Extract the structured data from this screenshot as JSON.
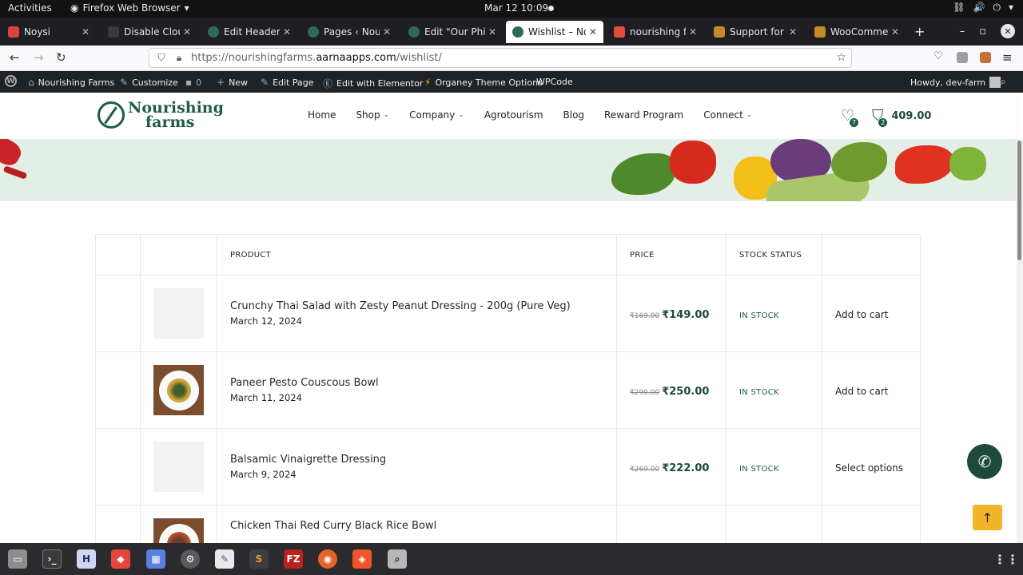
{
  "system": {
    "activities": "Activities",
    "app_name": "Firefox Web Browser",
    "clock": "Mar 12  10:09"
  },
  "tabs": [
    {
      "title": "Noysi",
      "favicon_color": "#d9453a"
    },
    {
      "title": "Disable Cloudfl",
      "favicon_color": "#3a3a3a"
    },
    {
      "title": "Edit Header Fo",
      "favicon_color": "#2e6b57"
    },
    {
      "title": "Pages ‹ Nourish",
      "favicon_color": "#2e6b57"
    },
    {
      "title": "Edit \"Our Philo",
      "favicon_color": "#2e6b57"
    },
    {
      "title": "Wishlist – Nour",
      "favicon_color": "#2e6b57"
    },
    {
      "title": "nourishing farm",
      "favicon_color": "#e44c3a"
    },
    {
      "title": "Support for On",
      "favicon_color": "#c38a2a"
    },
    {
      "title": "WooCommerce",
      "favicon_color": "#c38a2a"
    }
  ],
  "url": {
    "prefix": "https://nourishingfarms.",
    "domain": "aarnaapps.com",
    "path": "/wishlist/"
  },
  "wp_admin": {
    "site": "Nourishing Farms",
    "customize": "Customize",
    "comments": "0",
    "new": "New",
    "edit_page": "Edit Page",
    "elementor": "Edit with Elementor",
    "theme_options": "Organey Theme Options",
    "wpcode": "WPCode",
    "howdy": "Howdy, dev-farm"
  },
  "site": {
    "logo_line1": "Nourishing",
    "logo_line2": "farms",
    "menu": [
      "Home",
      "Shop",
      "Company",
      "Agrotourism",
      "Blog",
      "Reward Program",
      "Connect"
    ],
    "wishlist_count": "7",
    "cart_count": "2",
    "cart_total": "409.00"
  },
  "table": {
    "headers": {
      "product": "PRODUCT",
      "price": "PRICE",
      "stock": "STOCK STATUS"
    },
    "rows": [
      {
        "name": "Crunchy Thai Salad with Zesty Peanut Dressing - 200g (Pure Veg)",
        "date": "March 12, 2024",
        "old_price": "₹169.00",
        "price": "₹149.00",
        "stock": "IN STOCK",
        "action": "Add to cart"
      },
      {
        "name": "Paneer Pesto Couscous Bowl",
        "date": "March 11, 2024",
        "old_price": "₹290.00",
        "price": "₹250.00",
        "stock": "IN STOCK",
        "action": "Add to cart"
      },
      {
        "name": "Balsamic Vinaigrette Dressing",
        "date": "March 9, 2024",
        "old_price": "₹269.00",
        "price": "₹222.00",
        "stock": "IN STOCK",
        "action": "Select options"
      },
      {
        "name": "Chicken Thai Red Curry Black Rice Bowl"
      }
    ]
  },
  "colors": {
    "brand_green": "#1d5c47",
    "accent_yellow": "#f2b428",
    "admin_bar": "#1d2327"
  }
}
